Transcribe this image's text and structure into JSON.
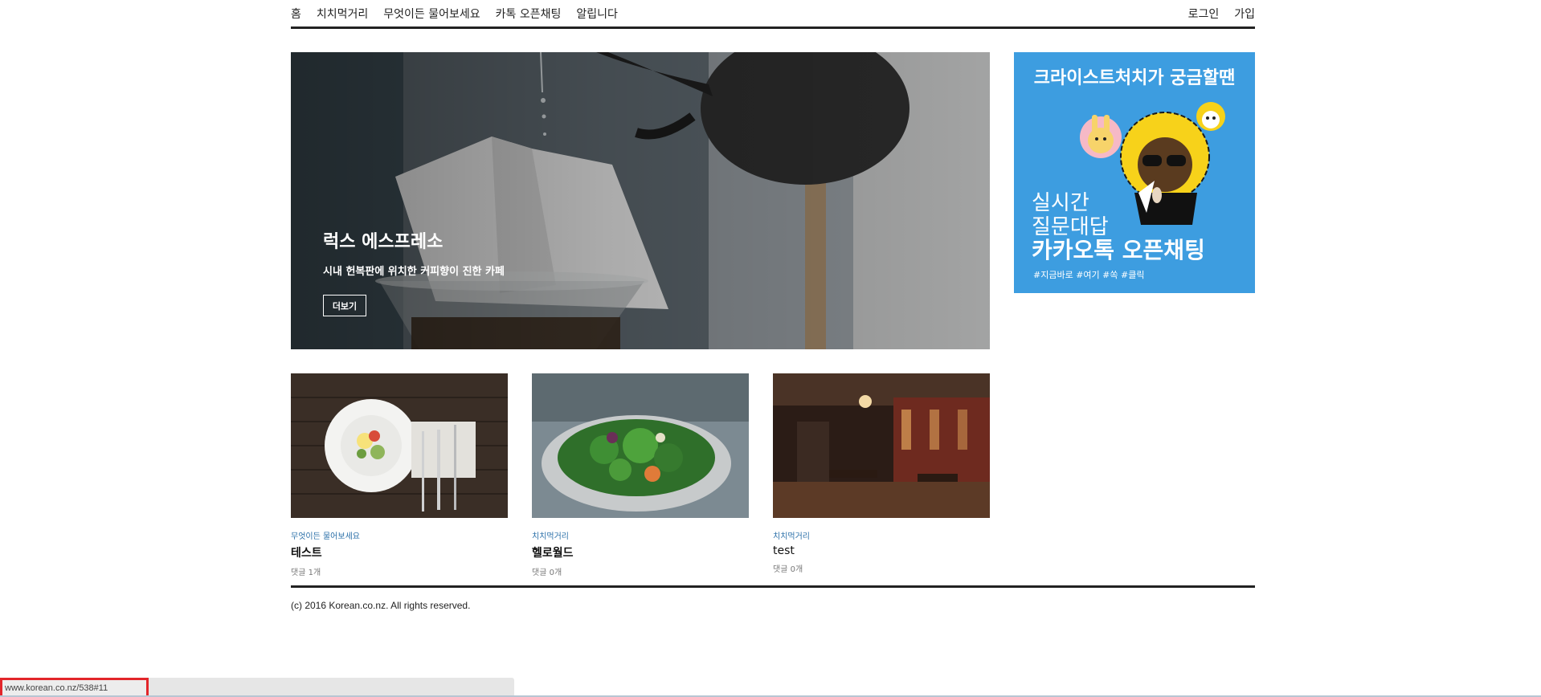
{
  "nav": {
    "left": [
      "홈",
      "치치먹거리",
      "무엇이든 물어보세요",
      "카톡 오픈채팅",
      "알립니다"
    ],
    "right": [
      "로그인",
      "가입"
    ]
  },
  "hero": {
    "title": "럭스 에스프레소",
    "subtitle": "시내 헌복판에 위치한 커피향이 진한 카페",
    "button_label": "더보기"
  },
  "ad": {
    "headline": "크라이스트처치가 궁금할땐",
    "line1": "실시간",
    "line2": "질문대답",
    "line3": "카카오톡 오픈채팅",
    "tags": "#지금바로 #여기 #쏙 #클릭",
    "colors": {
      "background": "#3d9de0"
    }
  },
  "cards": [
    {
      "category": "무엇이든 물어보세요",
      "title": "테스트",
      "comments": "댓글 1개",
      "image": "salad-plate-on-wood-table"
    },
    {
      "category": "치치먹거리",
      "title": "헬로월드",
      "comments": "댓글 0개",
      "image": "green-salad-bowl"
    },
    {
      "category": "치치먹거리",
      "title": "test",
      "comments": "댓글 0개",
      "image": "restaurant-interior"
    }
  ],
  "footer": {
    "copyright": "(c) 2016 Korean.co.nz. All rights reserved."
  },
  "status_bar": {
    "url": "www.korean.co.nz/538#11"
  }
}
